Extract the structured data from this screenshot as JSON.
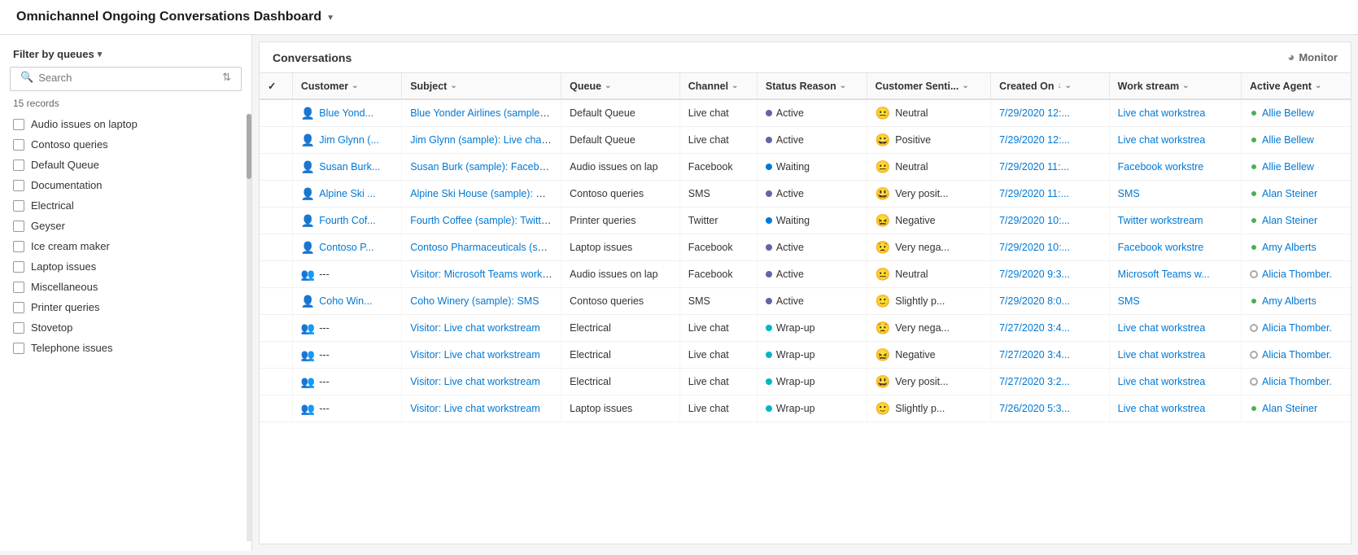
{
  "header": {
    "title": "Omnichannel Ongoing Conversations Dashboard",
    "chevron": "▾"
  },
  "sidebar": {
    "filter_label": "Filter by queues",
    "filter_chevron": "▾",
    "search_placeholder": "Search",
    "sort_icon": "⇅",
    "records_count": "15 records",
    "queues": [
      "Audio issues on laptop",
      "Contoso queries",
      "Default Queue",
      "Documentation",
      "Electrical",
      "Geyser",
      "Ice cream maker",
      "Laptop issues",
      "Miscellaneous",
      "Printer queries",
      "Stovetop",
      "Telephone issues"
    ]
  },
  "conversations_section": {
    "title": "Conversations",
    "monitor_label": "Monitor"
  },
  "table": {
    "columns": [
      "",
      "Customer",
      "Subject",
      "Queue",
      "Channel",
      "Status Reason",
      "Customer Senti...",
      "Created On",
      "Work stream",
      "Active Agent"
    ],
    "rows": [
      {
        "customer_icon": "person",
        "customer": "Blue Yond...",
        "subject": "Blue Yonder Airlines (sample): Live c",
        "queue": "Default Queue",
        "channel": "Live chat",
        "status_dot": "active",
        "status": "Active",
        "sentiment_icon": "neutral",
        "sentiment": "Neutral",
        "created": "7/29/2020 12:...",
        "workstream": "Live chat workstrea",
        "agent_dot": "green",
        "agent": "Allie Bellew"
      },
      {
        "customer_icon": "person",
        "customer": "Jim Glynn (...",
        "subject": "Jim Glynn (sample): Live chat works",
        "queue": "Default Queue",
        "channel": "Live chat",
        "status_dot": "active",
        "status": "Active",
        "sentiment_icon": "positive",
        "sentiment": "Positive",
        "created": "7/29/2020 12:...",
        "workstream": "Live chat workstrea",
        "agent_dot": "green",
        "agent": "Allie Bellew"
      },
      {
        "customer_icon": "person",
        "customer": "Susan Burk...",
        "subject": "Susan Burk (sample): Facebook wor",
        "queue": "Audio issues on lap",
        "channel": "Facebook",
        "status_dot": "waiting",
        "status": "Waiting",
        "sentiment_icon": "neutral",
        "sentiment": "Neutral",
        "created": "7/29/2020 11:...",
        "workstream": "Facebook workstre",
        "agent_dot": "green",
        "agent": "Allie Bellew"
      },
      {
        "customer_icon": "person",
        "customer": "Alpine Ski ...",
        "subject": "Alpine Ski House (sample): SMS",
        "queue": "Contoso queries",
        "channel": "SMS",
        "status_dot": "active",
        "status": "Active",
        "sentiment_icon": "verypositive",
        "sentiment": "Very posit...",
        "created": "7/29/2020 11:...",
        "workstream": "SMS",
        "agent_dot": "green",
        "agent": "Alan Steiner"
      },
      {
        "customer_icon": "person",
        "customer": "Fourth Cof...",
        "subject": "Fourth Coffee (sample): Twitter wor",
        "queue": "Printer queries",
        "channel": "Twitter",
        "status_dot": "waiting",
        "status": "Waiting",
        "sentiment_icon": "negative",
        "sentiment": "Negative",
        "created": "7/29/2020 10:...",
        "workstream": "Twitter workstream",
        "agent_dot": "green",
        "agent": "Alan Steiner"
      },
      {
        "customer_icon": "person",
        "customer": "Contoso P...",
        "subject": "Contoso Pharmaceuticals (sample):",
        "queue": "Laptop issues",
        "channel": "Facebook",
        "status_dot": "active",
        "status": "Active",
        "sentiment_icon": "verynegative",
        "sentiment": "Very nega...",
        "created": "7/29/2020 10:...",
        "workstream": "Facebook workstre",
        "agent_dot": "green",
        "agent": "Amy Alberts"
      },
      {
        "customer_icon": "visitor",
        "customer": "---",
        "subject": "Visitor: Microsoft Teams workstrea",
        "queue": "Audio issues on lap",
        "channel": "Facebook",
        "status_dot": "active",
        "status": "Active",
        "sentiment_icon": "neutral",
        "sentiment": "Neutral",
        "created": "7/29/2020 9:3...",
        "workstream": "Microsoft Teams w...",
        "agent_dot": "gray",
        "agent": "Alicia Thomber."
      },
      {
        "customer_icon": "person",
        "customer": "Coho Win...",
        "subject": "Coho Winery (sample): SMS",
        "queue": "Contoso queries",
        "channel": "SMS",
        "status_dot": "active",
        "status": "Active",
        "sentiment_icon": "slightlyp",
        "sentiment": "Slightly p...",
        "created": "7/29/2020 8:0...",
        "workstream": "SMS",
        "agent_dot": "green",
        "agent": "Amy Alberts"
      },
      {
        "customer_icon": "visitor",
        "customer": "---",
        "subject": "Visitor: Live chat workstream",
        "queue": "Electrical",
        "channel": "Live chat",
        "status_dot": "wrapup",
        "status": "Wrap-up",
        "sentiment_icon": "verynegative",
        "sentiment": "Very nega...",
        "created": "7/27/2020 3:4...",
        "workstream": "Live chat workstrea",
        "agent_dot": "gray",
        "agent": "Alicia Thomber."
      },
      {
        "customer_icon": "visitor",
        "customer": "---",
        "subject": "Visitor: Live chat workstream",
        "queue": "Electrical",
        "channel": "Live chat",
        "status_dot": "wrapup",
        "status": "Wrap-up",
        "sentiment_icon": "negative",
        "sentiment": "Negative",
        "created": "7/27/2020 3:4...",
        "workstream": "Live chat workstrea",
        "agent_dot": "gray",
        "agent": "Alicia Thomber."
      },
      {
        "customer_icon": "visitor",
        "customer": "---",
        "subject": "Visitor: Live chat workstream",
        "queue": "Electrical",
        "channel": "Live chat",
        "status_dot": "wrapup",
        "status": "Wrap-up",
        "sentiment_icon": "verypositive",
        "sentiment": "Very posit...",
        "created": "7/27/2020 3:2...",
        "workstream": "Live chat workstrea",
        "agent_dot": "gray",
        "agent": "Alicia Thomber."
      },
      {
        "customer_icon": "visitor",
        "customer": "---",
        "subject": "Visitor: Live chat workstream",
        "queue": "Laptop issues",
        "channel": "Live chat",
        "status_dot": "wrapup",
        "status": "Wrap-up",
        "sentiment_icon": "slightlyp",
        "sentiment": "Slightly p...",
        "created": "7/26/2020 5:3...",
        "workstream": "Live chat workstrea",
        "agent_dot": "green",
        "agent": "Alan Steiner"
      }
    ]
  }
}
